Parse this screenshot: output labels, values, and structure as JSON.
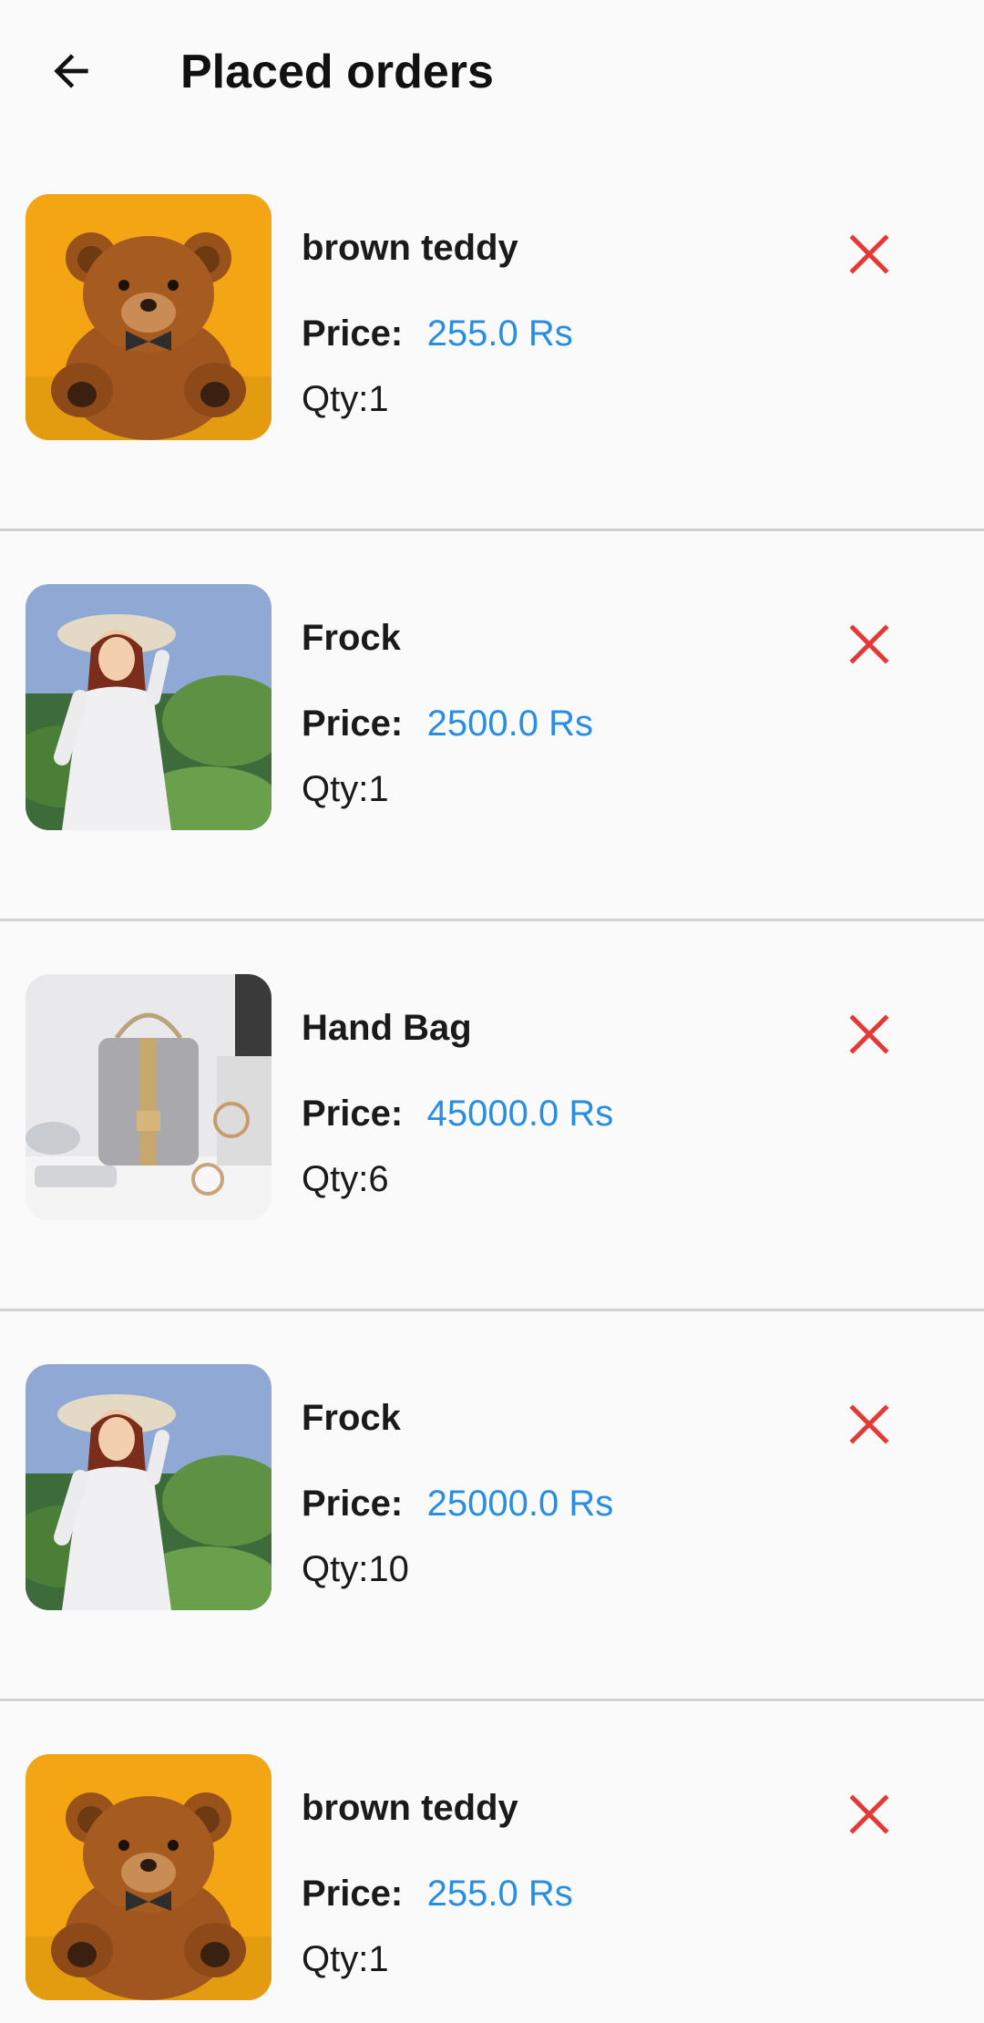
{
  "header": {
    "title": "Placed orders",
    "back_icon": "arrow-left-icon"
  },
  "labels": {
    "price": "Price:"
  },
  "colors": {
    "price_value": "#2a8ee0",
    "remove_icon": "#e53935",
    "divider": "#d2d2d2"
  },
  "orders": [
    {
      "name": "brown teddy",
      "price": "255.0 Rs",
      "qty": "Qty:1",
      "image": "teddy-bear-photo",
      "remove_icon": "close-icon"
    },
    {
      "name": "Frock",
      "price": "2500.0 Rs",
      "qty": "Qty:1",
      "image": "woman-frock-photo",
      "remove_icon": "close-icon"
    },
    {
      "name": "Hand Bag",
      "price": "45000.0 Rs",
      "qty": "Qty:6",
      "image": "handbag-photo",
      "remove_icon": "close-icon"
    },
    {
      "name": "Frock",
      "price": "25000.0 Rs",
      "qty": "Qty:10",
      "image": "woman-frock-photo",
      "remove_icon": "close-icon"
    },
    {
      "name": "brown teddy",
      "price": "255.0 Rs",
      "qty": "Qty:1",
      "image": "teddy-bear-photo",
      "remove_icon": "close-icon"
    }
  ]
}
